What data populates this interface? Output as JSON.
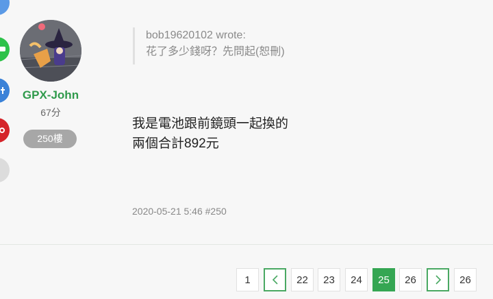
{
  "share_buttons": [
    {
      "name": "share-blue-icon",
      "color": "#5b9ae6"
    },
    {
      "name": "share-line-icon",
      "color": "#2ec24a"
    },
    {
      "name": "share-facebook-icon",
      "color": "#3b82d8"
    },
    {
      "name": "share-pinterest-icon",
      "color": "#d5242a"
    },
    {
      "name": "share-more-icon",
      "color": "#dcdcdc"
    }
  ],
  "author": {
    "username": "GPX-John",
    "score": "67分",
    "floor_badge": "250樓"
  },
  "quote": {
    "author_line": "bob19620102 wrote:",
    "text": "花了多少錢呀？先問起(恕刪)"
  },
  "post": {
    "line1": "我是電池跟前鏡頭一起換的",
    "line2": "兩個合計892元",
    "meta": "2020-05-21 5:46 #250"
  },
  "pagination": {
    "first": "1",
    "prev_icon": "chevron-left-icon",
    "pages": [
      "22",
      "23",
      "24",
      "25",
      "26"
    ],
    "current": "25",
    "next_icon": "chevron-right-icon",
    "last": "26"
  },
  "colors": {
    "accent_green": "#35a653",
    "username_green": "#2f9a4b",
    "badge_gray": "#a7a7a7"
  }
}
